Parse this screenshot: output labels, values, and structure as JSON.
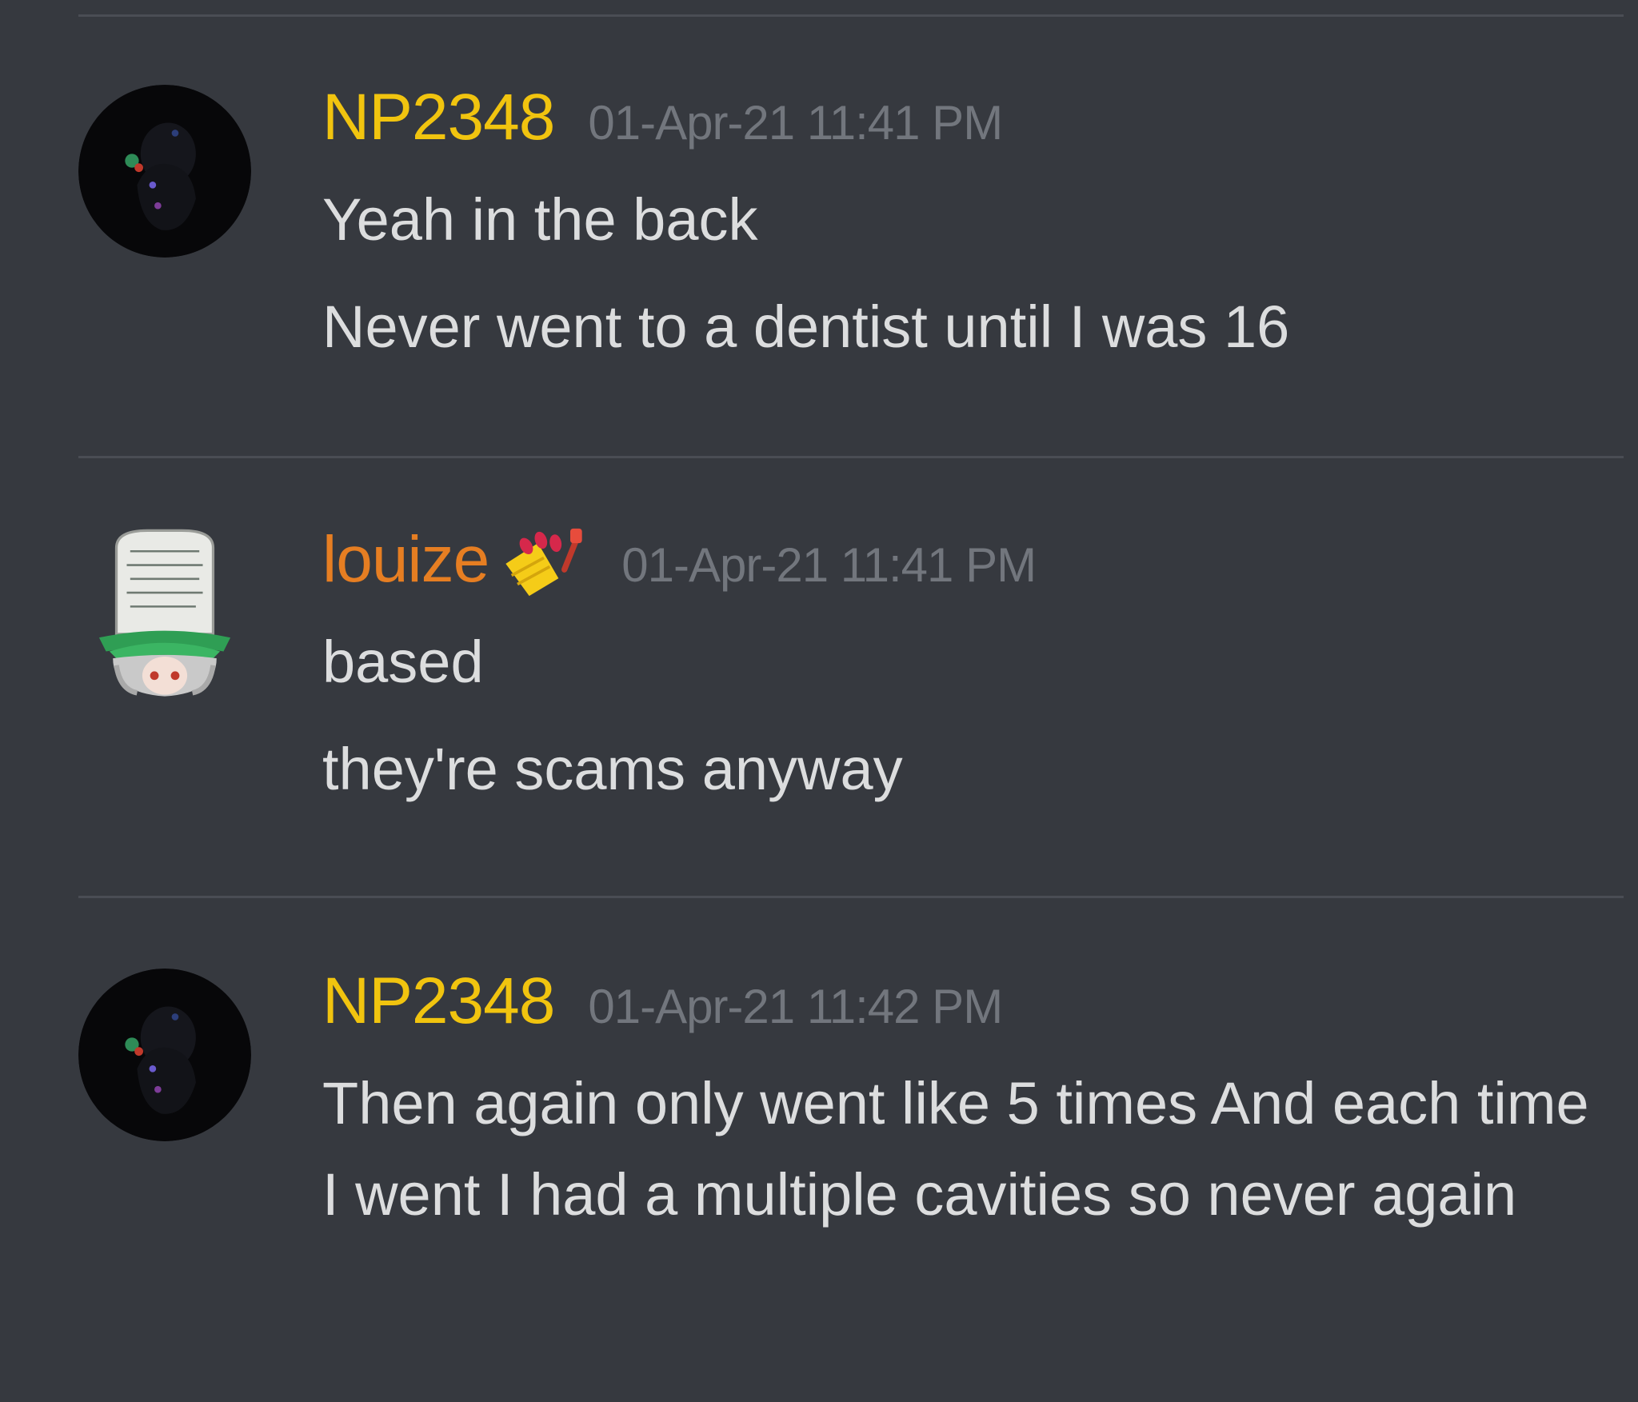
{
  "colors": {
    "background": "#36393f",
    "divider": "#4a4d54",
    "username_np": "#f1c40f",
    "username_louize": "#e67e22",
    "timestamp": "#72767d",
    "text": "#dcddde"
  },
  "messages": [
    {
      "author": "NP2348",
      "timestamp": "01-Apr-21 11:41 PM",
      "avatar_icon": "dark-figure-avatar-icon",
      "lines": [
        "Yeah in the back",
        "Never went to a dentist until I was 16"
      ]
    },
    {
      "author": "louize",
      "badge_icon": "nail-polish-emoji-icon",
      "timestamp": "01-Apr-21 11:41 PM",
      "avatar_icon": "anime-girl-tombstone-avatar-icon",
      "lines": [
        "based",
        "they're scams anyway"
      ]
    },
    {
      "author": "NP2348",
      "timestamp": "01-Apr-21 11:42 PM",
      "avatar_icon": "dark-figure-avatar-icon",
      "lines": [
        "Then again only went like 5 times And each time I went I had a multiple cavities so never again"
      ]
    }
  ]
}
